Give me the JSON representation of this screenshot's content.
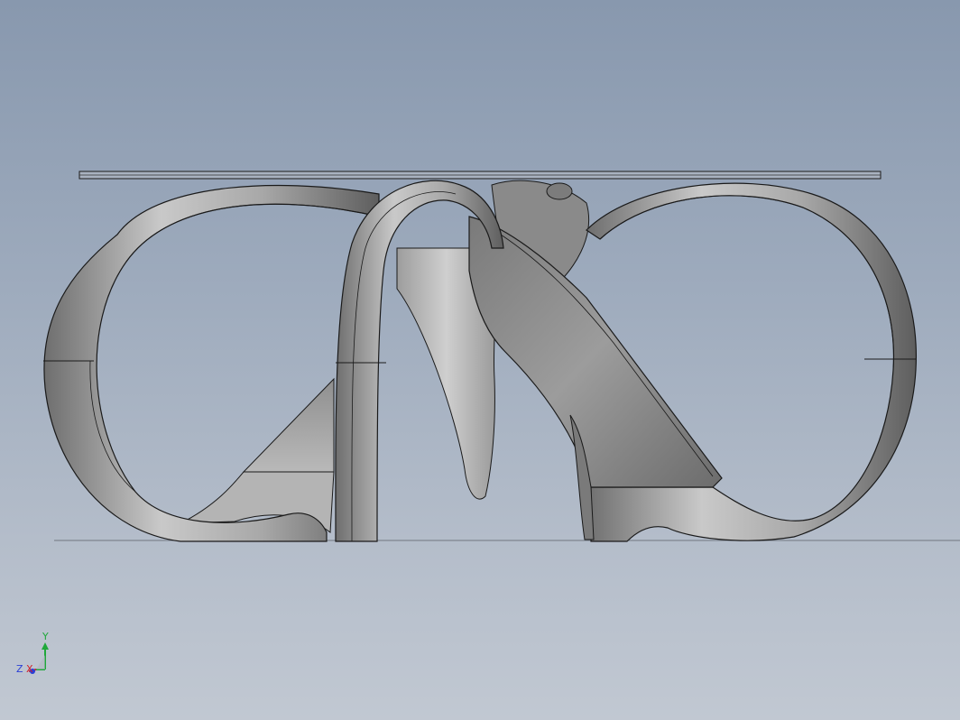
{
  "viewport": {
    "background_top": "#8898ae",
    "background_bottom": "#c1c8d2"
  },
  "model": {
    "surface_color": "#8c8c8c",
    "edge_color": "#111111",
    "highlight_color": "#d8d8d8"
  },
  "triad": {
    "x_label": "X",
    "y_label": "Y",
    "z_label": "Z",
    "x_color": "#d0202a",
    "y_color": "#1fa83a",
    "z_color": "#2b3fd6"
  }
}
